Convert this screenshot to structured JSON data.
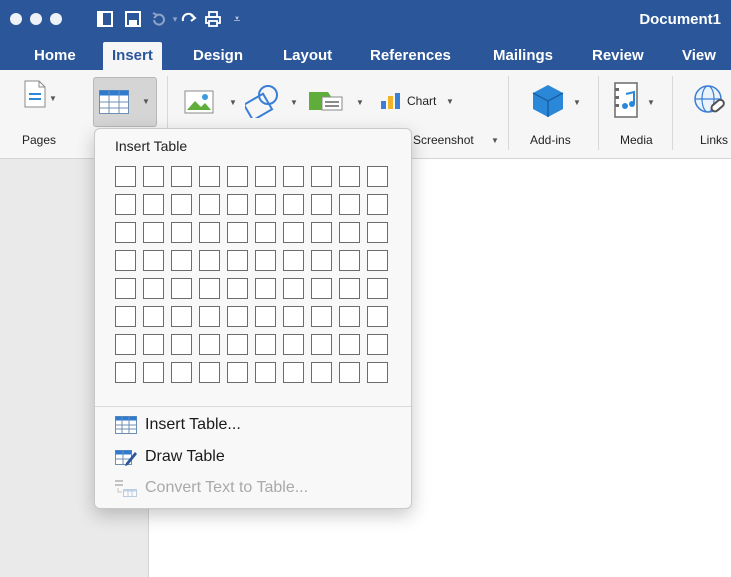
{
  "window": {
    "title": "Document1",
    "traffic_lights": [
      "close",
      "minimize",
      "zoom"
    ]
  },
  "quick_access": [
    {
      "icon": "sidebar-icon"
    },
    {
      "icon": "save-icon"
    },
    {
      "icon": "undo-icon"
    },
    {
      "icon": "redo-icon"
    },
    {
      "icon": "print-icon"
    },
    {
      "icon": "customize-icon"
    }
  ],
  "tabs": [
    {
      "label": "Home"
    },
    {
      "label": "Insert",
      "active": true
    },
    {
      "label": "Design"
    },
    {
      "label": "Layout"
    },
    {
      "label": "References"
    },
    {
      "label": "Mailings"
    },
    {
      "label": "Review"
    },
    {
      "label": "View"
    }
  ],
  "ribbon": {
    "pages_label": "Pages",
    "chart_label": "Chart",
    "screenshot_label": "Screenshot",
    "addins_label": "Add-ins",
    "media_label": "Media",
    "links_label": "Links"
  },
  "insert_table_menu": {
    "title": "Insert Table",
    "grid_columns": 10,
    "grid_rows": 8,
    "items": [
      {
        "label": "Insert Table...",
        "icon": "table-icon",
        "enabled": true
      },
      {
        "label": "Draw Table",
        "icon": "draw-table-icon",
        "enabled": true
      },
      {
        "label": "Convert Text to Table...",
        "icon": "convert-text-icon",
        "enabled": false
      }
    ]
  },
  "colors": {
    "titlebar": "#2b579a",
    "ribbon": "#f6f6f6",
    "accent_blue": "#2b579a"
  }
}
